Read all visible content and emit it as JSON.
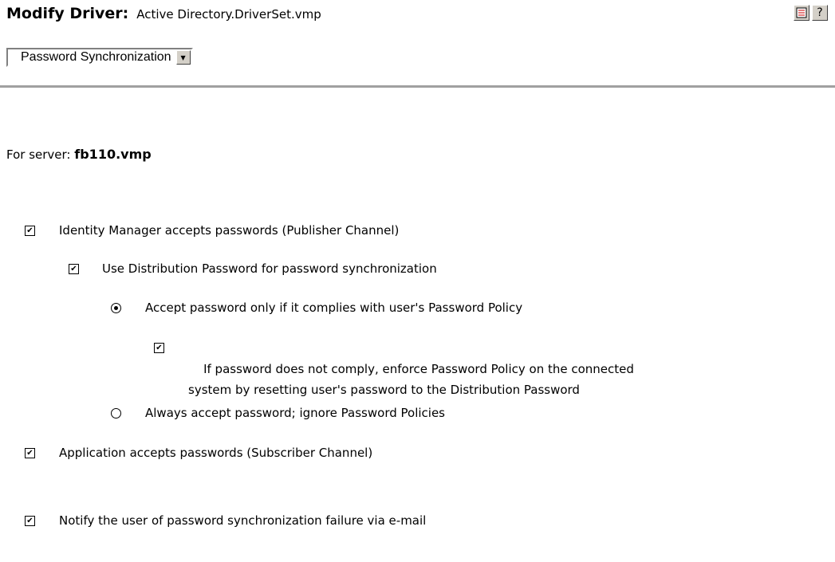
{
  "header": {
    "title_label": "Modify Driver:",
    "title_value": "Active Directory.DriverSet.vmp",
    "icons": [
      "tasks-icon",
      "help-icon"
    ]
  },
  "page_select": {
    "value": "Password Synchronization"
  },
  "server": {
    "label": "For server:",
    "name": "fb110.vmp"
  },
  "options": {
    "idm_accepts": {
      "label": "Identity Manager accepts passwords (Publisher Channel)",
      "checked": true
    },
    "use_distribution": {
      "label": "Use Distribution Password for password synchronization",
      "checked": true
    },
    "accept_complies": {
      "label": "Accept password only if it complies with user's Password Policy",
      "selected": true
    },
    "enforce_policy": {
      "label_line1": "If password does not comply, enforce Password Policy on the connected",
      "label_line2": "system by resetting user's password to the Distribution Password",
      "checked": true
    },
    "always_accept": {
      "label": "Always accept password; ignore Password Policies",
      "selected": false
    },
    "app_accepts": {
      "label": "Application accepts passwords (Subscriber Channel)",
      "checked": true
    },
    "notify_user": {
      "label": "Notify the user of password synchronization failure via e-mail",
      "checked": true
    }
  }
}
